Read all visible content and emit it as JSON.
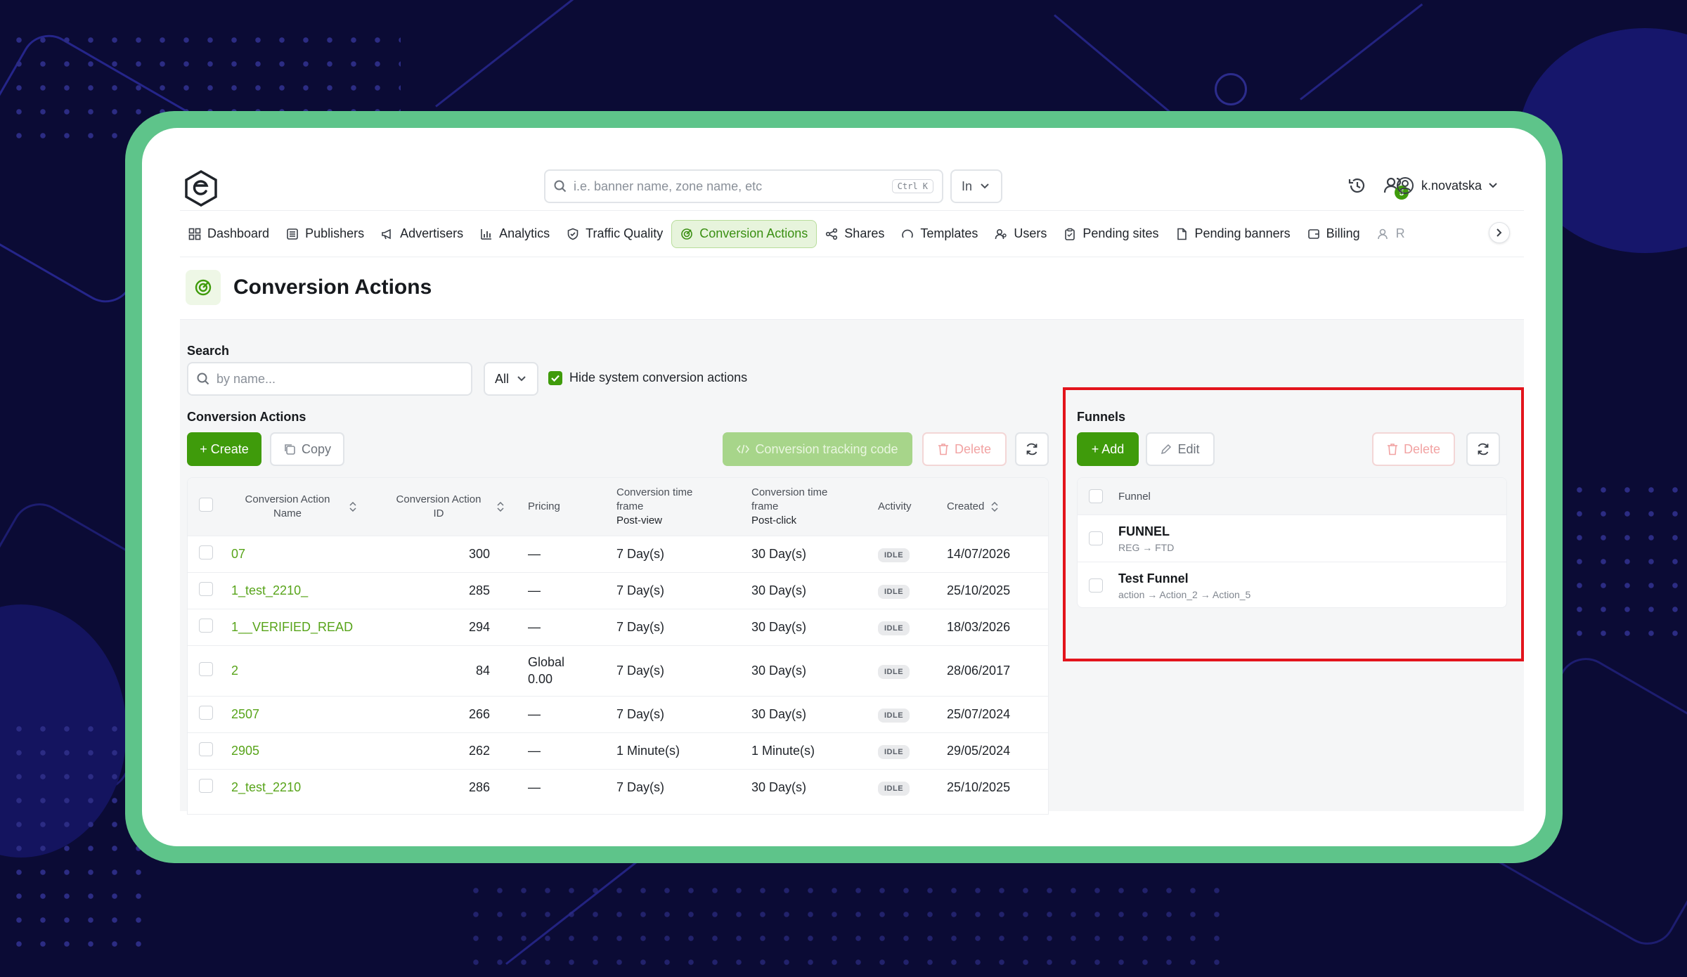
{
  "topbar": {
    "search_placeholder": "i.e. banner name, zone name, etc",
    "search_shortcut": "Ctrl K",
    "scope_value": "In",
    "username": "k.novatska",
    "notification_badge": "5"
  },
  "nav": {
    "items": [
      {
        "label": "Dashboard",
        "icon": "grid-icon"
      },
      {
        "label": "Publishers",
        "icon": "list-icon"
      },
      {
        "label": "Advertisers",
        "icon": "megaphone-icon"
      },
      {
        "label": "Analytics",
        "icon": "bar-chart-icon"
      },
      {
        "label": "Traffic Quality",
        "icon": "shield-icon"
      },
      {
        "label": "Conversion Actions",
        "icon": "target-icon",
        "active": true
      },
      {
        "label": "Shares",
        "icon": "share-icon"
      },
      {
        "label": "Templates",
        "icon": "template-icon"
      },
      {
        "label": "Users",
        "icon": "users-icon"
      },
      {
        "label": "Pending sites",
        "icon": "clipboard-icon"
      },
      {
        "label": "Pending banners",
        "icon": "file-icon"
      },
      {
        "label": "Billing",
        "icon": "wallet-icon"
      },
      {
        "label": "R",
        "icon": "user-icon"
      }
    ]
  },
  "page": {
    "title": "Conversion Actions"
  },
  "filters": {
    "search_label": "Search",
    "search_placeholder": "by name...",
    "type_value": "All",
    "hide_system_label": "Hide system conversion actions",
    "hide_system_checked": true
  },
  "conversion_actions": {
    "section_label": "Conversion Actions",
    "create_label": "+ Create",
    "copy_label": "Copy",
    "tracking_code_label": "Conversion tracking code",
    "delete_label": "Delete",
    "columns": {
      "name": "Conversion Action Name",
      "id": "Conversion Action ID",
      "pricing": "Pricing",
      "post_view_top": "Conversion time frame",
      "post_view_sub": "Post-view",
      "post_click_top": "Conversion time frame",
      "post_click_sub": "Post-click",
      "activity": "Activity",
      "created": "Created"
    },
    "rows": [
      {
        "name": "07",
        "id": "300",
        "pricing": "—",
        "pricing2": "",
        "post_view": "7 Day(s)",
        "post_click": "30 Day(s)",
        "activity": "IDLE",
        "created": "14/07/2026"
      },
      {
        "name": "1_test_2210_",
        "id": "285",
        "pricing": "—",
        "pricing2": "",
        "post_view": "7 Day(s)",
        "post_click": "30 Day(s)",
        "activity": "IDLE",
        "created": "25/10/2025"
      },
      {
        "name": "1__VERIFIED_READ",
        "id": "294",
        "pricing": "—",
        "pricing2": "",
        "post_view": "7 Day(s)",
        "post_click": "30 Day(s)",
        "activity": "IDLE",
        "created": "18/03/2026"
      },
      {
        "name": "2",
        "id": "84",
        "pricing": "Global",
        "pricing2": "0.00",
        "post_view": "7 Day(s)",
        "post_click": "30 Day(s)",
        "activity": "IDLE",
        "created": "28/06/2017"
      },
      {
        "name": "2507",
        "id": "266",
        "pricing": "—",
        "pricing2": "",
        "post_view": "7 Day(s)",
        "post_click": "30 Day(s)",
        "activity": "IDLE",
        "created": "25/07/2024"
      },
      {
        "name": "2905",
        "id": "262",
        "pricing": "—",
        "pricing2": "",
        "post_view": "1 Minute(s)",
        "post_click": "1 Minute(s)",
        "activity": "IDLE",
        "created": "29/05/2024"
      },
      {
        "name": "2_test_2210",
        "id": "286",
        "pricing": "—",
        "pricing2": "",
        "post_view": "7 Day(s)",
        "post_click": "30 Day(s)",
        "activity": "IDLE",
        "created": "25/10/2025"
      }
    ]
  },
  "funnels": {
    "section_label": "Funnels",
    "add_label": "+ Add",
    "edit_label": "Edit",
    "delete_label": "Delete",
    "column": "Funnel",
    "rows": [
      {
        "title": "FUNNEL",
        "steps": "REG → FTD"
      },
      {
        "title": "Test Funnel",
        "steps": "action → Action_2 → Action_5"
      }
    ]
  },
  "colors": {
    "accent": "#3f9b0b",
    "frame": "#5ec48a",
    "highlight": "#e3141c",
    "background": "#0b0b35"
  }
}
